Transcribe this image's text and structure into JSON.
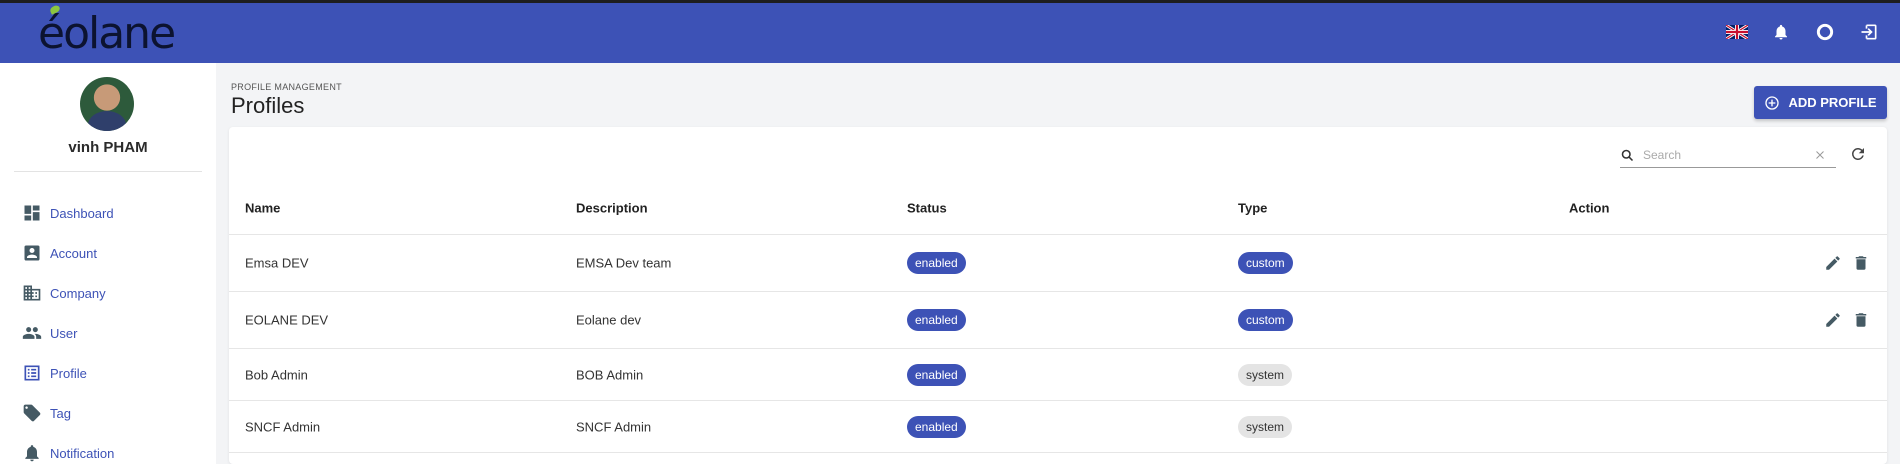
{
  "brand": {
    "logo_text": "éolane",
    "accent": "#8cc63f"
  },
  "colors": {
    "primary": "#3d52b6",
    "chip_system": "#e4e4e4"
  },
  "topbar": {
    "icons": [
      "uk-flag-icon",
      "bell-icon",
      "circle-icon",
      "logout-icon"
    ]
  },
  "user": {
    "name": "vinh PHAM"
  },
  "sidebar": {
    "items": [
      {
        "label": "Dashboard",
        "icon": "dashboard-icon"
      },
      {
        "label": "Account",
        "icon": "account-box-icon"
      },
      {
        "label": "Company",
        "icon": "building-icon"
      },
      {
        "label": "User",
        "icon": "people-icon"
      },
      {
        "label": "Profile",
        "icon": "list-box-icon"
      },
      {
        "label": "Tag",
        "icon": "tag-icon"
      },
      {
        "label": "Notification",
        "icon": "bell-icon"
      }
    ]
  },
  "header": {
    "breadcrumb": "PROFILE MANAGEMENT",
    "title": "Profiles",
    "add_label": "ADD PROFILE"
  },
  "search": {
    "placeholder": "Search"
  },
  "table": {
    "columns": [
      "Name",
      "Description",
      "Status",
      "Type",
      "Action"
    ],
    "rows": [
      {
        "name": "Emsa DEV",
        "description": "EMSA Dev team",
        "status": "enabled",
        "type": "custom"
      },
      {
        "name": "EOLANE DEV",
        "description": "Eolane dev",
        "status": "enabled",
        "type": "custom"
      },
      {
        "name": "Bob Admin",
        "description": "BOB Admin",
        "status": "enabled",
        "type": "system"
      },
      {
        "name": "SNCF Admin",
        "description": "SNCF Admin",
        "status": "enabled",
        "type": "system"
      }
    ]
  }
}
